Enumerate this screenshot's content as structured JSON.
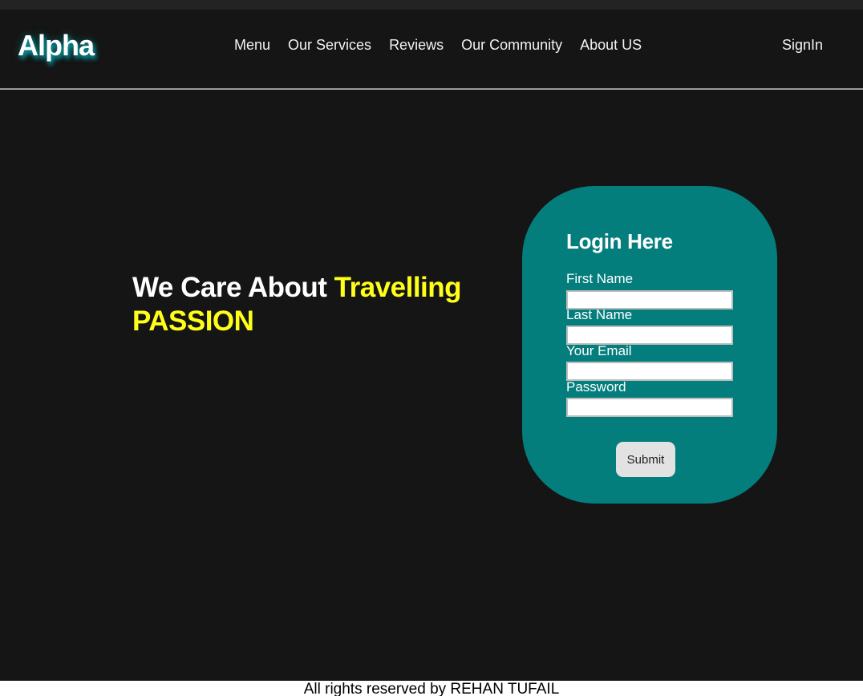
{
  "header": {
    "logo": "Alpha",
    "nav": [
      "Menu",
      "Our Services",
      "Reviews",
      "Our Community",
      "About US"
    ],
    "signin": "SignIn"
  },
  "hero": {
    "prefix": "We Care About ",
    "highlight": "Travelling PASSION"
  },
  "login": {
    "title": "Login Here",
    "fields": [
      {
        "label": "First Name",
        "value": ""
      },
      {
        "label": "Last Name",
        "value": ""
      },
      {
        "label": "Your Email",
        "value": ""
      },
      {
        "label": "Password",
        "value": ""
      }
    ],
    "submit": "Submit"
  },
  "footer": {
    "text": "All rights reserved by REHAN TUFAIL"
  },
  "colors": {
    "background": "#151515",
    "accent_yellow": "#ffff1a",
    "card_teal": "#047e7d",
    "logo_glow": "#00bec8"
  }
}
